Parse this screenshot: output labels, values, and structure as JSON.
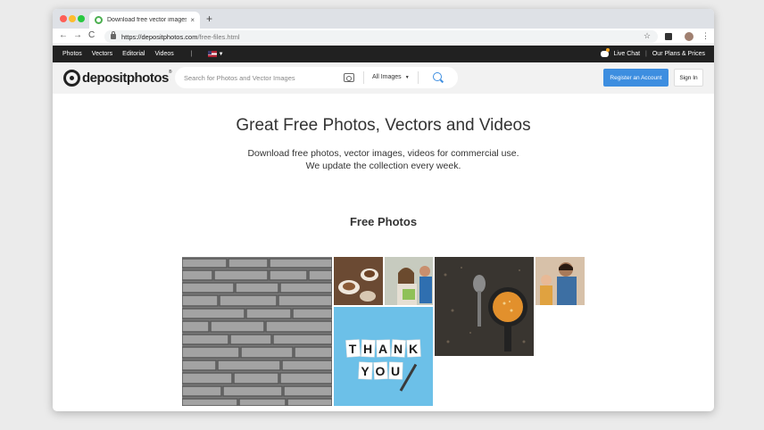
{
  "browser": {
    "tab_title": "Download free vector images a",
    "tab_close": "×",
    "new_tab": "+",
    "url_domain": "https://depositphotos.com",
    "url_path": "/free-files.html",
    "back": "←",
    "forward": "→",
    "reload": "C",
    "star": "☆",
    "menu": "⋮"
  },
  "topnav": {
    "links": [
      "Photos",
      "Vectors",
      "Editorial",
      "Videos"
    ],
    "separator": "|",
    "live_chat": "Live Chat",
    "divider": "|",
    "plans": "Our Plans & Prices"
  },
  "header": {
    "logo_text": "depositphotos",
    "logo_reg": "®",
    "search_placeholder": "Search for Photos and Vector Images",
    "filter": "All Images",
    "register": "Register an Account",
    "signin": "Sign In"
  },
  "main": {
    "title": "Great Free Photos, Vectors and Videos",
    "subtitle_line1": "Download free photos, vector images, videos for commercial use.",
    "subtitle_line2": "We update the collection every week.",
    "section_title": "Free Photos",
    "thank_card": [
      "THANK",
      "YOU"
    ]
  }
}
